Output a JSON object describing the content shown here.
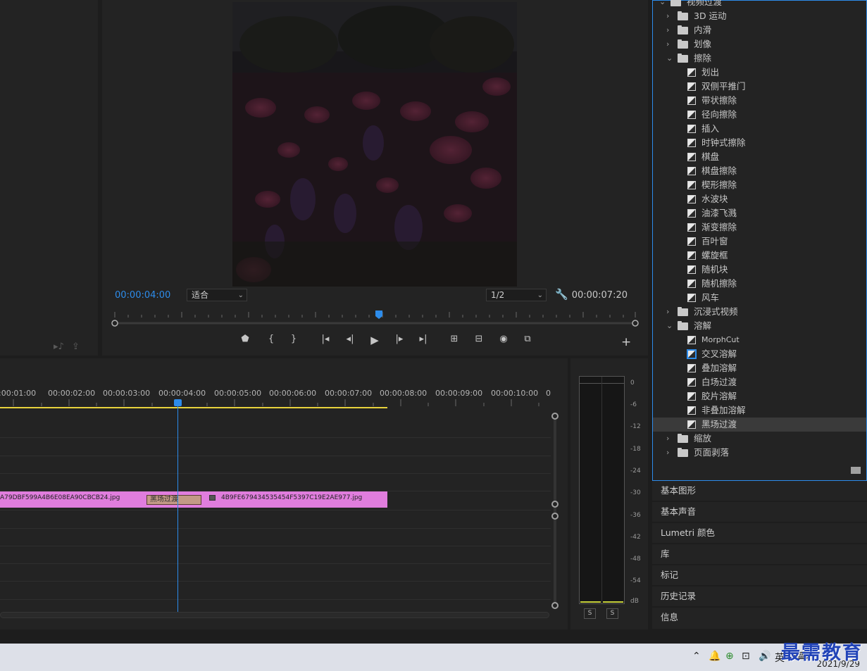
{
  "monitor": {
    "current_time": "00:00:04:00",
    "fit_label": "适合",
    "resolution_label": "1/2",
    "duration": "00:00:07:20"
  },
  "timeline": {
    "ruler": [
      ":00:01:00",
      "00:00:02:00",
      "00:00:03:00",
      "00:00:04:00",
      "00:00:05:00",
      "00:00:06:00",
      "00:00:07:00",
      "00:00:08:00",
      "00:00:09:00",
      "00:00:10:00",
      "0"
    ],
    "clip1_name": "A79DBF599A4B6E08EA90CBCB24.jpg",
    "clip2_name": "4B9FE679434535454F5397C19E2AE977.jpg",
    "transition_label": "黑场过渡"
  },
  "meter": {
    "db_labels": [
      "0",
      "-6",
      "-12",
      "-18",
      "-24",
      "-30",
      "-36",
      "-42",
      "-48",
      "-54",
      "dB"
    ],
    "solo_label": "S"
  },
  "effects": {
    "items": [
      {
        "type": "folder",
        "level": 0,
        "open": true,
        "label": "视频过渡"
      },
      {
        "type": "folder",
        "level": 1,
        "open": false,
        "label": "3D 运动"
      },
      {
        "type": "folder",
        "level": 1,
        "open": false,
        "label": "内滑"
      },
      {
        "type": "folder",
        "level": 1,
        "open": false,
        "label": "划像"
      },
      {
        "type": "folder",
        "level": 1,
        "open": true,
        "label": "擦除"
      },
      {
        "type": "fx",
        "label": "划出"
      },
      {
        "type": "fx",
        "label": "双侧平推门"
      },
      {
        "type": "fx",
        "label": "带状擦除"
      },
      {
        "type": "fx",
        "label": "径向擦除"
      },
      {
        "type": "fx",
        "label": "插入"
      },
      {
        "type": "fx",
        "label": "时钟式擦除"
      },
      {
        "type": "fx",
        "label": "棋盘"
      },
      {
        "type": "fx",
        "label": "棋盘擦除"
      },
      {
        "type": "fx",
        "label": "楔形擦除"
      },
      {
        "type": "fx",
        "label": "水波块"
      },
      {
        "type": "fx",
        "label": "油漆飞溅"
      },
      {
        "type": "fx",
        "label": "渐变擦除"
      },
      {
        "type": "fx",
        "label": "百叶窗"
      },
      {
        "type": "fx",
        "label": "螺旋框"
      },
      {
        "type": "fx",
        "label": "随机块"
      },
      {
        "type": "fx",
        "label": "随机擦除"
      },
      {
        "type": "fx",
        "label": "风车"
      },
      {
        "type": "folder",
        "level": 1,
        "open": false,
        "label": "沉浸式视频"
      },
      {
        "type": "folder",
        "level": 1,
        "open": true,
        "label": "溶解"
      },
      {
        "type": "fx",
        "label": "MorphCut"
      },
      {
        "type": "fx",
        "label": "交叉溶解",
        "highlight": true
      },
      {
        "type": "fx",
        "label": "叠加溶解"
      },
      {
        "type": "fx",
        "label": "白场过渡"
      },
      {
        "type": "fx",
        "label": "胶片溶解"
      },
      {
        "type": "fx",
        "label": "非叠加溶解"
      },
      {
        "type": "fx",
        "label": "黑场过渡",
        "selected": true
      },
      {
        "type": "folder",
        "level": 1,
        "open": false,
        "label": "缩放"
      },
      {
        "type": "folder",
        "level": 1,
        "open": false,
        "label": "页面剥落"
      }
    ]
  },
  "panels": [
    "基本图形",
    "基本声音",
    "Lumetri 颜色",
    "库",
    "标记",
    "历史记录",
    "信息"
  ],
  "taskbar": {
    "ime": "英",
    "date": "2021/9/29",
    "watermark": "最需教育"
  },
  "colors": {
    "accent": "#2d8ceb",
    "clip": "#e07ddd",
    "work_area": "#e8d23c",
    "transition": "#c39a86"
  }
}
